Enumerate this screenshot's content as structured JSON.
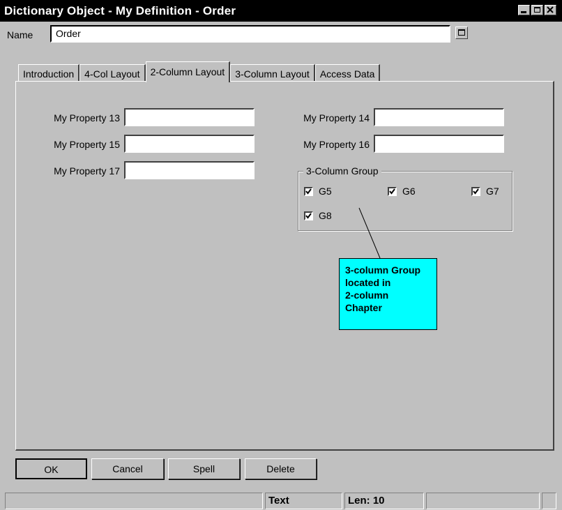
{
  "window": {
    "title": "Dictionary Object - My Definition - Order",
    "controls": [
      "minimize-icon",
      "maximize-icon",
      "close-icon"
    ]
  },
  "name_row": {
    "label": "Name",
    "value": "Order"
  },
  "tabs": [
    {
      "label": "Introduction",
      "active": false
    },
    {
      "label": "4-Col Layout",
      "active": false
    },
    {
      "label": "2-Column Layout",
      "active": true
    },
    {
      "label": "3-Column Layout",
      "active": false
    },
    {
      "label": "Access Data",
      "active": false
    }
  ],
  "fields": {
    "p13": {
      "label": "My Property 13",
      "value": ""
    },
    "p14": {
      "label": "My Property 14",
      "value": ""
    },
    "p15": {
      "label": "My Property 15",
      "value": ""
    },
    "p16": {
      "label": "My Property 16",
      "value": ""
    },
    "p17": {
      "label": "My Property 17",
      "value": ""
    }
  },
  "group": {
    "title": "3-Column Group",
    "items": [
      {
        "label": "G5",
        "checked": true
      },
      {
        "label": "G6",
        "checked": true
      },
      {
        "label": "G7",
        "checked": true
      },
      {
        "label": "G8",
        "checked": true
      }
    ]
  },
  "callout": {
    "lines": [
      "3-column Group",
      "located in",
      "2-column",
      "Chapter"
    ],
    "color": "#00ffff"
  },
  "buttons": {
    "ok": "OK",
    "cancel": "Cancel",
    "spell": "Spell",
    "delete": "Delete"
  },
  "status": {
    "mode": "Text",
    "length": "Len: 10"
  }
}
